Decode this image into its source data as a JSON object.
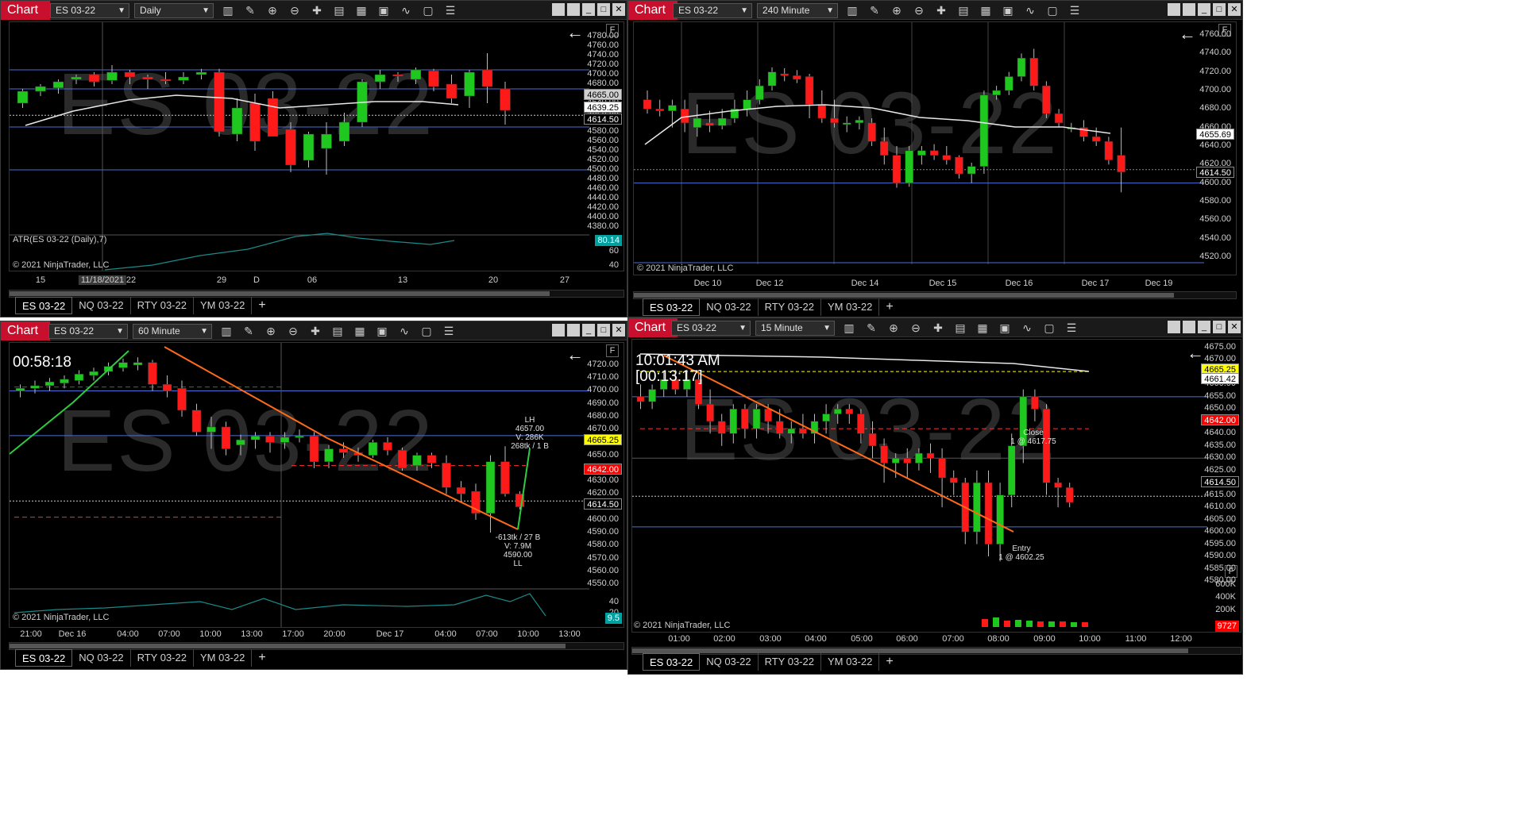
{
  "common": {
    "chart_label": "Chart",
    "copyright": "© 2021 NinjaTrader, LLC",
    "tabs": [
      "ES 03-22",
      "NQ 03-22",
      "RTY 03-22",
      "YM 03-22"
    ],
    "tab_add": "+",
    "f_label": "F",
    "back_icon": "←",
    "watermark": "ES 03-22"
  },
  "panels": [
    {
      "instrument": "ES 03-22",
      "period": "Daily",
      "axis": [
        "4780.00",
        "4760.00",
        "4740.00",
        "4720.00",
        "4700.00",
        "4680.00",
        "4660.00",
        "4640.00",
        "4620.00",
        "4600.00",
        "4580.00",
        "4560.00",
        "4540.00",
        "4520.00",
        "4500.00",
        "4480.00",
        "4460.00",
        "4440.00",
        "4420.00",
        "4400.00",
        "4380.00"
      ],
      "price_tags": [
        {
          "v": "4665.00",
          "c": "#d0d0d0",
          "t": "#000"
        },
        {
          "v": "4639.25",
          "c": "#ffffff",
          "t": "#000"
        },
        {
          "v": "4614.50",
          "c": "#000",
          "t": "#fff"
        }
      ],
      "indicator_label": "ATR(ES 03-22 (Daily),7)",
      "indicator_tag": "80.14",
      "indicator_axis": [
        "60",
        "40"
      ],
      "x_ticks": [
        "15",
        "11/18/2021",
        "22",
        "29",
        "D",
        "06",
        "13",
        "20",
        "27"
      ]
    },
    {
      "instrument": "ES 03-22",
      "period": "240 Minute",
      "axis": [
        "4760.00",
        "4740.00",
        "4720.00",
        "4700.00",
        "4680.00",
        "4660.00",
        "4640.00",
        "4620.00",
        "4600.00",
        "4580.00",
        "4560.00",
        "4540.00",
        "4520.00"
      ],
      "price_tags": [
        {
          "v": "4655.69",
          "c": "#ffffff",
          "t": "#000"
        },
        {
          "v": "4614.50",
          "c": "#000",
          "t": "#fff"
        }
      ],
      "x_ticks": [
        "Dec 10",
        "Dec 12",
        "Dec 14",
        "Dec 15",
        "Dec 16",
        "Dec 17",
        "Dec 19"
      ]
    },
    {
      "instrument": "ES 03-22",
      "period": "60 Minute",
      "axis": [
        "4720.00",
        "4710.00",
        "4700.00",
        "4690.00",
        "4680.00",
        "4670.00",
        "4660.00",
        "4650.00",
        "4640.00",
        "4630.00",
        "4620.00",
        "4610.00",
        "4600.00",
        "4590.00",
        "4580.00",
        "4570.00",
        "4560.00",
        "4550.00"
      ],
      "price_tags": [
        {
          "v": "4665.25",
          "c": "#ffff00",
          "t": "#000"
        },
        {
          "v": "4642.00",
          "c": "#ff0000",
          "t": "#fff"
        },
        {
          "v": "4614.50",
          "c": "#000",
          "t": "#fff"
        }
      ],
      "timer": "00:58:18",
      "annot_top": [
        "LH",
        "4657.00",
        "V: 286K",
        "268tk / 1 B"
      ],
      "annot_bottom": [
        "-613tk / 27 B",
        "V: 7.9M",
        "4590.00",
        "LL"
      ],
      "indicator_tag": "9.5",
      "indicator_axis": [
        "40",
        "20"
      ],
      "x_ticks": [
        "21:00",
        "Dec 16",
        "04:00",
        "07:00",
        "10:00",
        "13:00",
        "17:00",
        "20:00",
        "Dec 17",
        "04:00",
        "07:00",
        "10:00",
        "13:00"
      ]
    },
    {
      "instrument": "ES 03-22",
      "period": "15 Minute",
      "axis": [
        "4675.00",
        "4670.00",
        "4665.00",
        "4660.00",
        "4655.00",
        "4650.00",
        "4645.00",
        "4640.00",
        "4635.00",
        "4630.00",
        "4625.00",
        "4620.00",
        "4615.00",
        "4610.00",
        "4605.00",
        "4600.00",
        "4595.00",
        "4590.00",
        "4585.00",
        "4580.00"
      ],
      "price_tags": [
        {
          "v": "4665.25",
          "c": "#ffff00",
          "t": "#000"
        },
        {
          "v": "4661.42",
          "c": "#ffffff",
          "t": "#000"
        },
        {
          "v": "4642.00",
          "c": "#ff0000",
          "t": "#fff"
        },
        {
          "v": "4614.50",
          "c": "#000",
          "t": "#fff"
        }
      ],
      "clock": "10:01:43 AM",
      "timer": "[00:13:17]",
      "close_label": [
        "Close",
        "1 @ 4617.75"
      ],
      "entry_label": [
        "Entry",
        "1 @ 4602.25"
      ],
      "volume_axis": [
        "600K",
        "400K",
        "200K"
      ],
      "volume_tag": "9727",
      "x_ticks": [
        "01:00",
        "02:00",
        "03:00",
        "04:00",
        "05:00",
        "06:00",
        "07:00",
        "08:00",
        "09:00",
        "10:00",
        "11:00",
        "12:00"
      ]
    }
  ],
  "chart_data": [
    {
      "type": "line",
      "title": "ES 03-22 Daily",
      "x": [
        "15",
        "11/18/2021",
        "22",
        "29",
        "D",
        "06",
        "13",
        "20",
        "27"
      ],
      "ylim": [
        4380,
        4780
      ],
      "series": []
    },
    {
      "type": "line",
      "title": "ES 03-22 240 Minute",
      "x": [
        "Dec 10",
        "Dec 12",
        "Dec 14",
        "Dec 15",
        "Dec 16",
        "Dec 17",
        "Dec 19"
      ],
      "ylim": [
        4520,
        4760
      ],
      "series": []
    },
    {
      "type": "line",
      "title": "ES 03-22 60 Minute",
      "x": [
        "21:00",
        "Dec 16",
        "04:00",
        "07:00",
        "10:00",
        "13:00",
        "17:00",
        "20:00",
        "Dec 17",
        "04:00",
        "07:00",
        "10:00",
        "13:00"
      ],
      "ylim": [
        4550,
        4720
      ],
      "series": []
    },
    {
      "type": "line",
      "title": "ES 03-22 15 Minute",
      "x": [
        "01:00",
        "02:00",
        "03:00",
        "04:00",
        "05:00",
        "06:00",
        "07:00",
        "08:00",
        "09:00",
        "10:00",
        "11:00",
        "12:00"
      ],
      "ylim": [
        4580,
        4675
      ],
      "series": []
    }
  ]
}
